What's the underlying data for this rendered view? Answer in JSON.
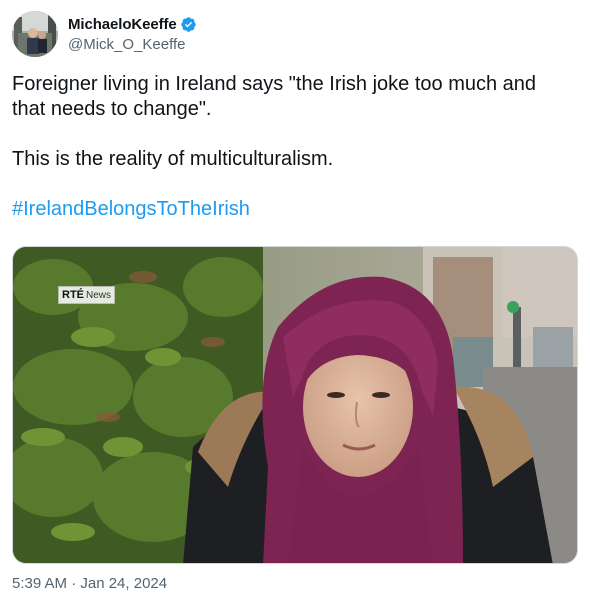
{
  "author": {
    "display_name": "MichaeloKeeffe",
    "handle": "@Mick_O_Keeffe",
    "verified": true,
    "avatar_icon": "profile-photo"
  },
  "tweet": {
    "paragraph1": "Foreigner living in Ireland says \"the Irish joke too much and that needs to change\".",
    "paragraph2": "This is the reality of multiculturalism.",
    "hashtag": "#IrelandBelongsToTheIrish",
    "timestamp": "5:39 AM · Jan 24, 2024"
  },
  "media": {
    "type": "video-still",
    "watermark_brand": "RTÉ",
    "watermark_label": "News"
  },
  "colors": {
    "link": "#1d9bf0",
    "text": "#0f1419",
    "secondary": "#536471",
    "verified": "#1d9bf0",
    "hijab": "#8a2a55"
  }
}
